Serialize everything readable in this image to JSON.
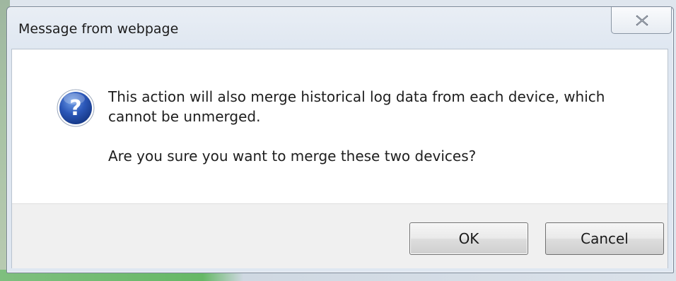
{
  "dialog": {
    "title": "Message from webpage",
    "icon": "question-icon",
    "message_lines": [
      "This action will also merge historical log data from each device, which cannot be unmerged.",
      "Are you sure you want to merge these two devices?"
    ],
    "buttons": {
      "ok": "OK",
      "cancel": "Cancel"
    },
    "close_icon": "close-icon"
  },
  "colors": {
    "icon_blue": "#2b57b8",
    "title_text": "#1b1b1b",
    "footer_bg": "#f0f0f0"
  }
}
